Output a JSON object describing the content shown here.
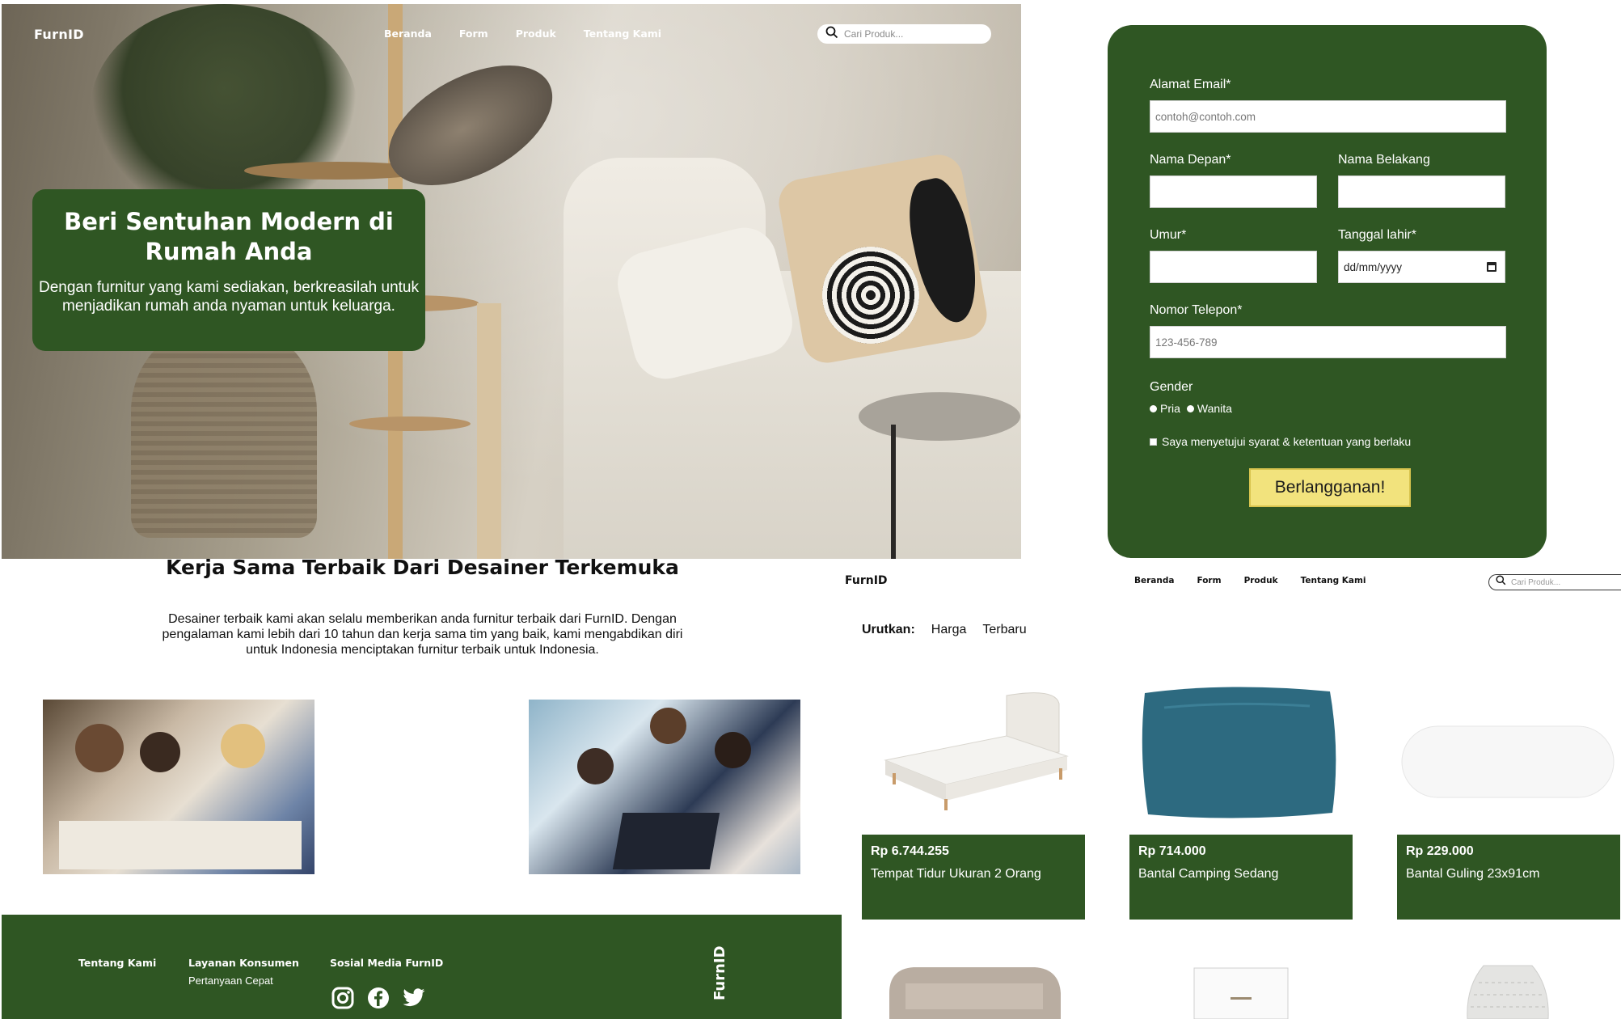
{
  "hero": {
    "logo": "FurnID",
    "nav": [
      "Beranda",
      "Form",
      "Produk",
      "Tentang Kami"
    ],
    "search_placeholder": "Cari Produk...",
    "card_title": "Beri Sentuhan Modern di Rumah Anda",
    "card_text": "Dengan furnitur yang kami sediakan, berkreasilah untuk menjadikan rumah anda nyaman untuk keluarga."
  },
  "form": {
    "email_label": "Alamat Email*",
    "email_placeholder": "contoh@contoh.com",
    "first_name_label": "Nama Depan*",
    "last_name_label": "Nama Belakang",
    "age_label": "Umur*",
    "birth_label": "Tanggal lahir*",
    "birth_placeholder": "dd/mm/yyyy",
    "phone_label": "Nomor Telepon*",
    "phone_placeholder": "123-456-789",
    "gender_label": "Gender",
    "gender_options": [
      "Pria",
      "Wanita"
    ],
    "terms_label": "Saya menyetujui syarat & ketentuan yang berlaku",
    "submit_label": "Berlangganan!"
  },
  "designers": {
    "title": "Kerja Sama Terbaik Dari Desainer Terkemuka",
    "desc": "Desainer terbaik kami akan selalu memberikan anda furnitur terbaik dari FurnID. Dengan pengalaman kami lebih dari 10 tahun dan kerja sama tim yang baik, kami mengabdikan diri untuk Indonesia menciptakan furnitur terbaik untuk Indonesia."
  },
  "footer": {
    "about": "Tentang Kami",
    "service": "Layanan Konsumen",
    "service_sub": "Pertanyaan Cepat",
    "social": "Sosial Media FurnID",
    "logo": "FurnID"
  },
  "products_page": {
    "logo": "FurnID",
    "nav": [
      "Beranda",
      "Form",
      "Produk",
      "Tentang Kami"
    ],
    "search_placeholder": "Cari Produk...",
    "sort_label": "Urutkan:",
    "sort_options": [
      "Harga",
      "Terbaru"
    ],
    "products": [
      {
        "price": "Rp 6.744.255",
        "name": "Tempat Tidur Ukuran 2 Orang",
        "icon": "bed-image"
      },
      {
        "price": "Rp 714.000",
        "name": "Bantal Camping Sedang",
        "icon": "pillow-image"
      },
      {
        "price": "Rp 229.000",
        "name": "Bantal Guling 23x91cm",
        "icon": "bolster-image"
      }
    ]
  },
  "colors": {
    "brand_green": "#2f5623",
    "button_yellow": "#f2e37d"
  }
}
